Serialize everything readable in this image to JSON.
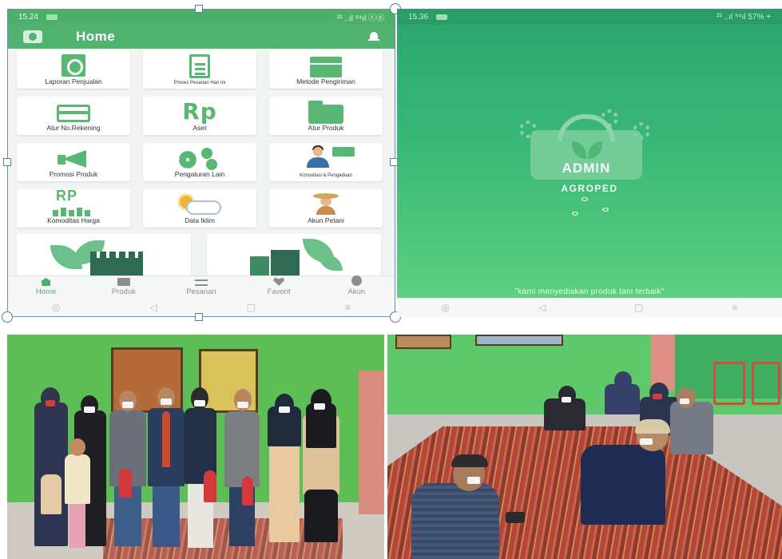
{
  "left_app": {
    "status_time": "15.24",
    "status_right": "²² ..ıl ⁹⁴ıl ⓒⓓ",
    "title": "Home",
    "tiles": [
      {
        "label": "Laporan Penjualan",
        "icon": "report-icon"
      },
      {
        "label": "Proses Pesanan Hari Ini",
        "icon": "clipboard-icon"
      },
      {
        "label": "Metode Pengiriman",
        "icon": "box-icon"
      },
      {
        "label": "Atur No.Rekening",
        "icon": "card-icon"
      },
      {
        "label": "Aset",
        "icon": "rp-icon"
      },
      {
        "label": "Atur Produk",
        "icon": "folder-icon"
      },
      {
        "label": "Promosi Produk",
        "icon": "megaphone-icon"
      },
      {
        "label": "Pengaturan Lain",
        "icon": "gears-icon"
      },
      {
        "label": "Konsultasi & Pengaduan",
        "icon": "consult-icon"
      },
      {
        "label": "Komoditas Harga",
        "icon": "price-bars-icon"
      },
      {
        "label": "Data Iklim",
        "icon": "weather-icon"
      },
      {
        "label": "Akun Petani",
        "icon": "farmer-icon"
      }
    ],
    "nav": [
      {
        "label": "Home",
        "icon": "home-icon",
        "active": true
      },
      {
        "label": "Produk",
        "icon": "folder-icon",
        "active": false
      },
      {
        "label": "Pesanan",
        "icon": "list-icon",
        "active": false
      },
      {
        "label": "Favorit",
        "icon": "heart-icon",
        "active": false
      },
      {
        "label": "Akun",
        "icon": "person-icon",
        "active": false
      }
    ],
    "system_nav": [
      "◎",
      "◁",
      "▢",
      "≡"
    ]
  },
  "right_app": {
    "status_time": "15.36",
    "status_right": "²² ..ıl ⁹⁴ıl 57% +",
    "logo_text": "ADMIN",
    "app_name": "AGROPED",
    "tagline": "\"kami menyediakan produk tani terbaik\"",
    "system_nav": [
      "◎",
      "◁",
      "▢",
      "≡"
    ]
  },
  "colors": {
    "brand_green": "#52b272",
    "splash_top": "#2da86e",
    "splash_bottom": "#5cd07f",
    "wall_green": "#5dbe55"
  }
}
